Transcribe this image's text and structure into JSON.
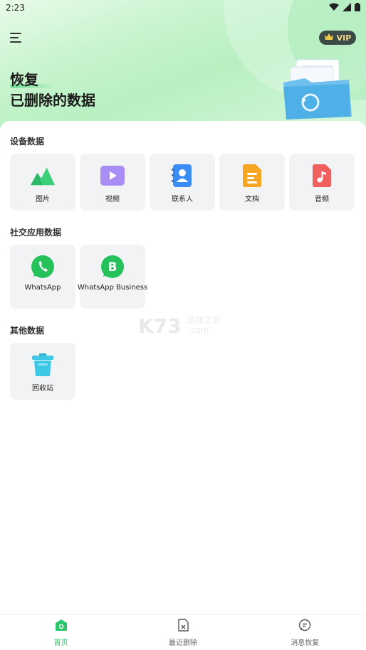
{
  "status_bar": {
    "time": "2:23"
  },
  "header": {
    "vip_label": "VIP",
    "title_line1": "恢复",
    "title_line2": "已删除的数据"
  },
  "sections": [
    {
      "title": "设备数据",
      "items": [
        {
          "label": "图片",
          "icon": "image-icon",
          "color": "#3ccf7a"
        },
        {
          "label": "视频",
          "icon": "video-icon",
          "color": "#a98df5"
        },
        {
          "label": "联系人",
          "icon": "contact-icon",
          "color": "#3a8df5"
        },
        {
          "label": "文档",
          "icon": "document-icon",
          "color": "#f6a623"
        },
        {
          "label": "音频",
          "icon": "audio-icon",
          "color": "#f0605e"
        }
      ]
    },
    {
      "title": "社交应用数据",
      "items": [
        {
          "label": "WhatsApp",
          "icon": "whatsapp-icon",
          "color": "#25c15a"
        },
        {
          "label": "WhatsApp Business",
          "icon": "whatsapp-business-icon",
          "color": "#25c15a"
        }
      ]
    },
    {
      "title": "其他数据",
      "items": [
        {
          "label": "回收站",
          "icon": "recycle-bin-icon",
          "color": "#3cc8e6"
        }
      ]
    }
  ],
  "watermark": {
    "brand": "K73",
    "cn": "游戏之家",
    "domain": ".com"
  },
  "bottom_nav": [
    {
      "label": "首页",
      "icon": "home-icon",
      "active": true
    },
    {
      "label": "最近删除",
      "icon": "recent-deleted-icon",
      "active": false
    },
    {
      "label": "消息恢复",
      "icon": "message-recovery-icon",
      "active": false
    }
  ]
}
